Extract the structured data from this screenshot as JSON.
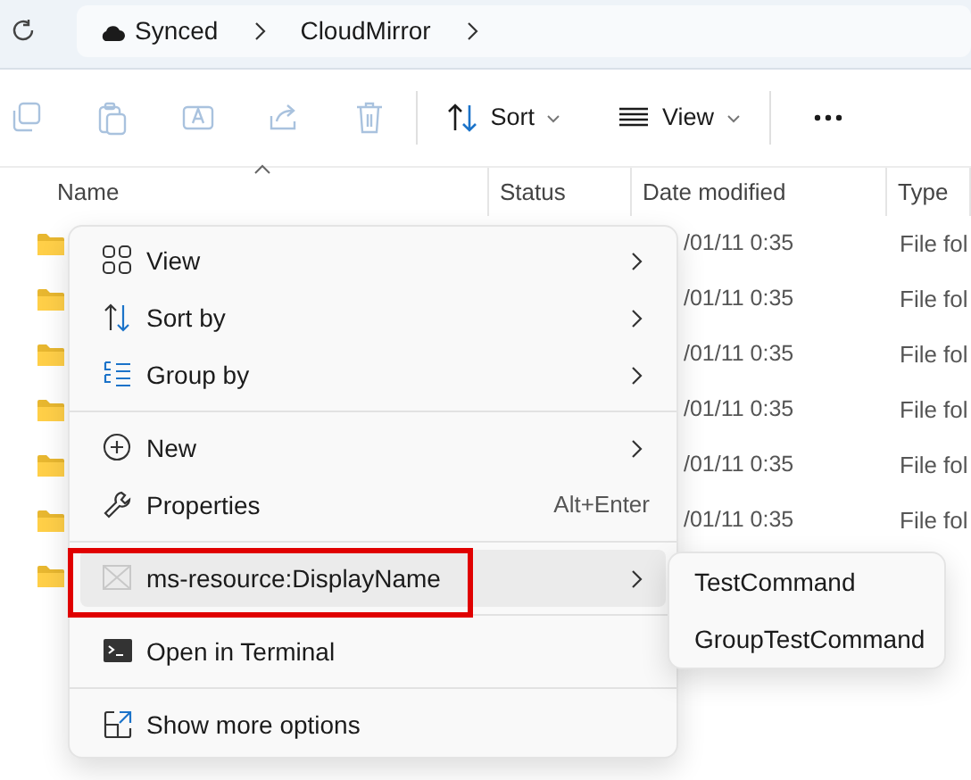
{
  "breadcrumb": {
    "items": [
      "Synced",
      "CloudMirror"
    ]
  },
  "toolbar": {
    "actions": [
      {
        "disabled": true
      },
      {
        "disabled": true
      },
      {
        "disabled": true
      },
      {
        "disabled": true
      },
      {
        "disabled": true
      }
    ],
    "dropdowns": [
      {
        "label": "Sort"
      },
      {
        "label": "View"
      }
    ]
  },
  "table": {
    "columns": [
      {
        "label": "Name",
        "sorted": true
      },
      {
        "label": "Status",
        "sorted": false
      },
      {
        "label": "Date modified",
        "sorted": false
      },
      {
        "label": "Type",
        "sorted": false
      }
    ],
    "rows": [
      {
        "date_modified": "/01/11 0:35",
        "type": "File fol"
      },
      {
        "date_modified": "/01/11 0:35",
        "type": "File fol"
      },
      {
        "date_modified": "/01/11 0:35",
        "type": "File fol"
      },
      {
        "date_modified": "/01/11 0:35",
        "type": "File fol"
      },
      {
        "date_modified": "/01/11 0:35",
        "type": "File fol"
      },
      {
        "date_modified": "/01/11 0:35",
        "type": "File fol"
      },
      {}
    ]
  },
  "context_menu": {
    "groups": [
      [
        {
          "label": "View",
          "submenu": true,
          "selected": false,
          "outlined": false
        },
        {
          "label": "Sort by",
          "submenu": true,
          "selected": false,
          "outlined": false
        },
        {
          "label": "Group by",
          "submenu": true,
          "selected": false,
          "outlined": false
        }
      ],
      [
        {
          "label": "New",
          "submenu": true,
          "selected": false,
          "outlined": false
        },
        {
          "label": "Properties",
          "submenu": false,
          "shortcut": "Alt+Enter",
          "selected": false,
          "outlined": false
        }
      ],
      [
        {
          "label": "ms-resource:DisplayName",
          "submenu": true,
          "selected": true,
          "outlined": true
        }
      ],
      [
        {
          "label": "Open in Terminal",
          "submenu": false,
          "selected": false,
          "outlined": false
        }
      ],
      [
        {
          "label": "Show more options",
          "submenu": false,
          "selected": false,
          "outlined": false
        }
      ]
    ]
  },
  "submenu": {
    "items": [
      "TestCommand",
      "GroupTestCommand"
    ]
  }
}
